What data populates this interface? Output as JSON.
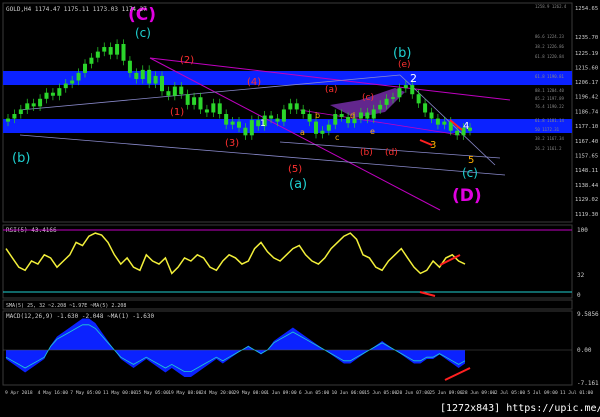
{
  "header": {
    "title": "GOLD,H4  1174.47 1175.11 1173.03 1174.27"
  },
  "watermark": "[1272x843] https://upic.me/",
  "colors": {
    "bg": "#000000",
    "candle": "#2bd62b",
    "zone": "#0b22ff",
    "magenta": "#c000c0",
    "macd": "#0b22ff",
    "rsi": "#f2ef3a",
    "label_blue": "#1fd1d1",
    "label_magenta": "#e000e0",
    "label_red": "#ff3030",
    "label_orange": "#ffb000"
  },
  "panels": {
    "rsi": {
      "label": "RSI(5) 43.4166",
      "ticks": [
        "100",
        "32",
        "0"
      ]
    },
    "small": {
      "label": "SMA(5) 25, 32 ~2.208  ~1.97E  ~MA(5) 2.208"
    },
    "macd": {
      "label": "MACD(12,26,9) -1.630 -2.048  ~MA(1) -1.630",
      "ticks": [
        "9.5856",
        "0.00",
        "-7.161"
      ]
    }
  },
  "chart_data": {
    "type": "candlestick",
    "symbol": "GOLD",
    "timeframe": "H4",
    "y_ticks": [
      "1254.65",
      "1235.70",
      "1225.19",
      "1215.60",
      "1206.17",
      "1196.42",
      "1186.74",
      "1177.10",
      "1167.40",
      "1157.65",
      "1148.11",
      "1138.44",
      "1129.02",
      "1119.30"
    ],
    "x_ticks": [
      "9 Apr 2018",
      "4 May 16:00",
      "7 May 05:00",
      "11 May 00:00",
      "15 May 05:00",
      "19 May 08:00",
      "24 May 20:00",
      "29 May 08:00",
      "1 Jun 09:00",
      "6 Jun 05:00",
      "10 Jun 06:00",
      "15 Jun 05:00",
      "20 Jun 07:00",
      "25 Jun 09:00",
      "28 Jun 09:00",
      "2 Jul 05:00",
      "5 Jul 09:00",
      "11 Jul 01:00"
    ],
    "close": [
      1182,
      1185,
      1188,
      1192,
      1190,
      1195,
      1199,
      1197,
      1202,
      1205,
      1207,
      1212,
      1218,
      1222,
      1226,
      1229,
      1224,
      1231,
      1220,
      1212,
      1208,
      1214,
      1205,
      1210,
      1200,
      1197,
      1203,
      1198,
      1191,
      1196,
      1188,
      1186,
      1192,
      1185,
      1178,
      1180,
      1176,
      1171,
      1181,
      1177,
      1184,
      1182,
      1180,
      1188,
      1192,
      1188,
      1185,
      1180,
      1172,
      1174,
      1178,
      1185,
      1183,
      1179,
      1182,
      1186,
      1182,
      1188,
      1191,
      1195,
      1196,
      1202,
      1204,
      1198,
      1192,
      1186,
      1182,
      1178,
      1180,
      1174,
      1171,
      1176,
      1174
    ],
    "fib_levels": [
      "1258.9 1262.4",
      "86.6 1224.23",
      "38.2 1226.86",
      "61.8 1220.84",
      "61.8 1190.81",
      "88.1 1204.40",
      "85.2 1197.89",
      "76.4 1190.22",
      "61.8 1181.14",
      "50 1172.31",
      "38.2 1167.34",
      "26.2 1161.2"
    ],
    "wave_labels": [
      "(C)",
      "(c)",
      "(b)",
      "(b)",
      "(a)",
      "(D)",
      "(c)",
      "(2)",
      "(4)",
      "(1)",
      "(3)",
      "(5)",
      "(a)",
      "(b)",
      "(c)",
      "(d)",
      "(e)",
      "1",
      "2",
      "3",
      "4",
      "5",
      "a",
      "b",
      "c",
      "d",
      "e"
    ],
    "rsi": [
      70,
      55,
      40,
      35,
      50,
      45,
      60,
      55,
      40,
      50,
      60,
      80,
      75,
      90,
      95,
      92,
      80,
      60,
      45,
      55,
      40,
      35,
      60,
      50,
      45,
      55,
      30,
      40,
      55,
      50,
      60,
      55,
      40,
      35,
      50,
      60,
      55,
      45,
      50,
      70,
      80,
      65,
      55,
      50,
      60,
      70,
      75,
      60,
      50,
      45,
      55,
      70,
      80,
      90,
      95,
      85,
      60,
      55,
      40,
      35,
      50,
      60,
      70,
      55,
      40,
      30,
      35,
      50,
      40,
      55,
      60,
      50,
      45
    ],
    "macd": [
      -2,
      -3,
      -4,
      -5,
      -4,
      -3,
      -2,
      1,
      3,
      4,
      5,
      6,
      7,
      7,
      6,
      4,
      2,
      0,
      -2,
      -3,
      -4,
      -3,
      -2,
      -3,
      -4,
      -5,
      -4,
      -5,
      -6,
      -6,
      -5,
      -4,
      -3,
      -2,
      -3,
      -2,
      -1,
      0,
      1,
      0,
      -1,
      0,
      2,
      3,
      4,
      5,
      4,
      3,
      2,
      1,
      0,
      -1,
      -2,
      -3,
      -3,
      -2,
      -1,
      0,
      1,
      2,
      1,
      0,
      -1,
      -2,
      -3,
      -3,
      -2,
      -2,
      -1,
      -2,
      -3,
      -4,
      -3
    ]
  }
}
